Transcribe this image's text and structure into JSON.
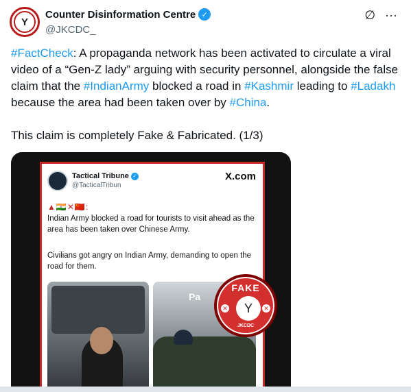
{
  "account": {
    "display_name": "Counter Disinformation Centre",
    "handle": "@JKCDC_",
    "verified_icon": "✓"
  },
  "header_icons": {
    "grok_icon": "∅",
    "more_icon": "···"
  },
  "tweet": {
    "p1_tag1": "#FactCheck",
    "p1_text1": ": A propaganda network has been activated to circulate a viral video of a “Gen-Z lady” arguing with security personnel, alongside the false claim that the ",
    "p1_tag2": "#IndianArmy",
    "p1_text2": " blocked a road in ",
    "p1_tag3": "#Kashmir",
    "p1_text3": " leading to ",
    "p1_tag4": "#Ladakh",
    "p1_text4": " because the area had been taken over by ",
    "p1_tag5": "#China",
    "p1_text5": ".",
    "claim": "This claim is completely Fake & Fabricated. (1/3)"
  },
  "embedded": {
    "name": "Tactical Tribune",
    "handle": "@TacticalTribun",
    "brand": "X.com",
    "flags": "▲🇮🇳✕🇨🇳:",
    "line1": "Indian Army blocked a road for tourists to visit ahead as the area has been taken over Chinese Army.",
    "line2": "Civilians got angry on Indian Army, demanding to open the road for them.",
    "photo_text": "Pa",
    "stamp_text": "FAKE",
    "stamp_org": "JKCDC",
    "stamp_x": "✕"
  },
  "colors": {
    "link": "#1d9bf0",
    "stamp": "#d32f2f"
  }
}
